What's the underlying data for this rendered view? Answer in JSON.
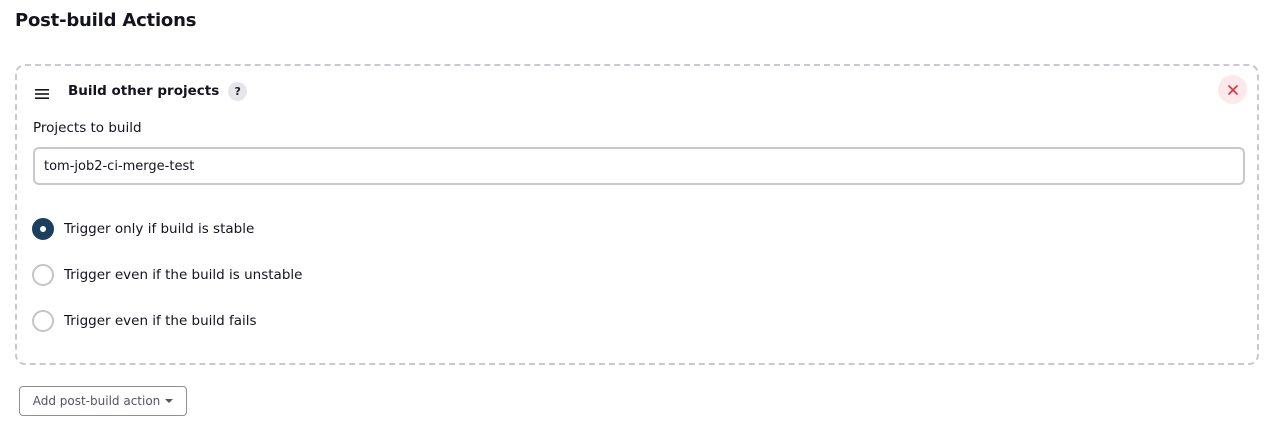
{
  "section": {
    "title": "Post-build Actions"
  },
  "card": {
    "title": "Build other projects",
    "help_glyph": "?",
    "drag_icon": "hamburger-menu-icon",
    "close_icon": "close-x-icon"
  },
  "projects_field": {
    "label": "Projects to build",
    "value": "tom-job2-ci-merge-test"
  },
  "trigger_options": [
    {
      "label": "Trigger only if build is stable",
      "checked": true
    },
    {
      "label": "Trigger even if the build is unstable",
      "checked": false
    },
    {
      "label": "Trigger even if the build fails",
      "checked": false
    }
  ],
  "add_action": {
    "label": "Add post-build action",
    "icon": "caret-down-icon"
  },
  "colors": {
    "radio_checked": "#1a4060",
    "close_bg": "#fbe9ec",
    "close_x": "#e0303c",
    "dashed_border": "#c9c9cf"
  }
}
